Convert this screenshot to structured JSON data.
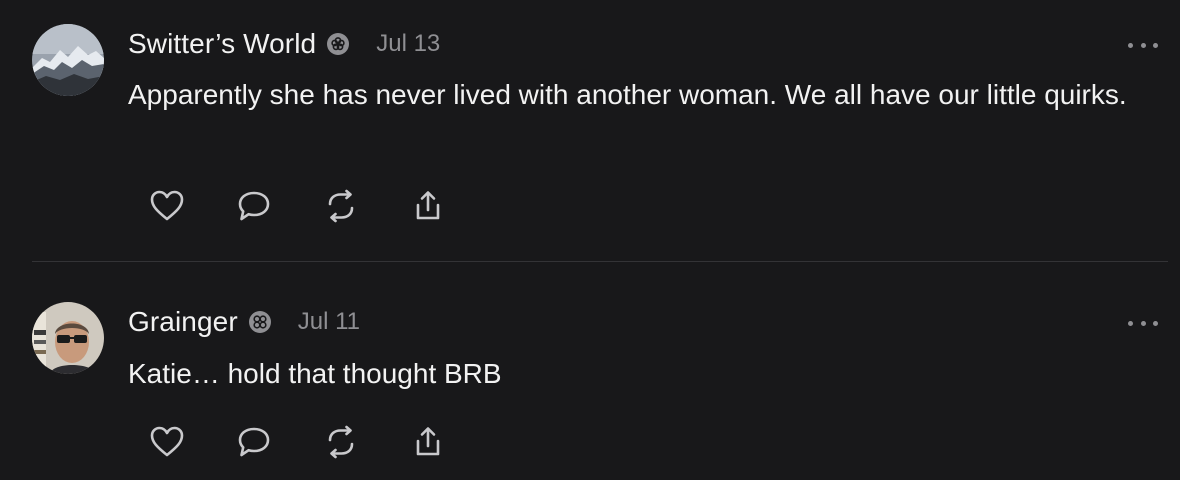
{
  "colors": {
    "background": "#18181a",
    "text": "#f2f2f2",
    "muted": "#8f8f93",
    "divider": "#333336"
  },
  "posts": [
    {
      "author": "Switter’s World",
      "verified_icon": "verified-badge-icon",
      "date": "Jul 13",
      "text": "Apparently she has never lived with another woman. We all have our little quirks.",
      "actions": [
        "heart-icon",
        "comment-icon",
        "repost-icon",
        "share-icon"
      ],
      "more_icon": "more-options-icon"
    },
    {
      "author": "Grainger",
      "verified_icon": "verified-badge-icon",
      "date": "Jul 11",
      "text": "Katie… hold that thought BRB",
      "actions": [
        "heart-icon",
        "comment-icon",
        "repost-icon",
        "share-icon"
      ],
      "more_icon": "more-options-icon"
    }
  ]
}
